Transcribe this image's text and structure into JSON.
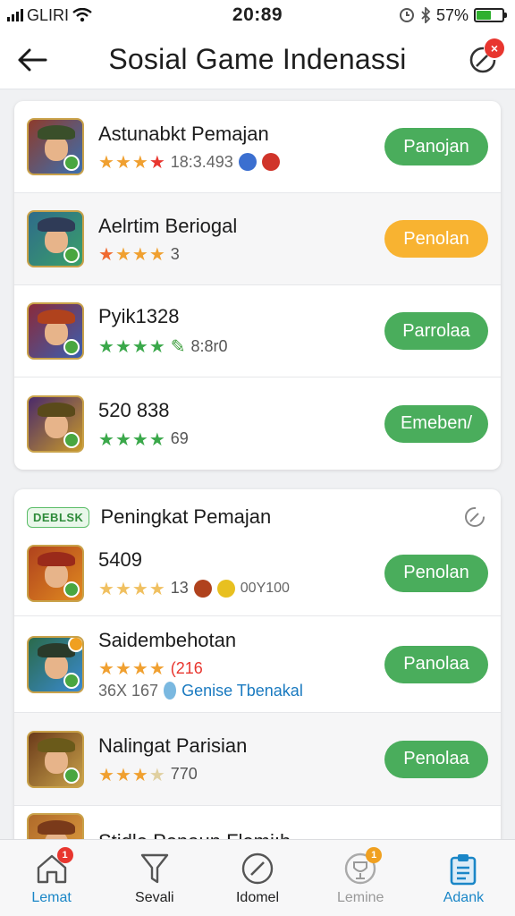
{
  "status_bar": {
    "carrier": "GLIRI",
    "time": "20:89",
    "battery": "57%",
    "battery_level": 0.57
  },
  "header": {
    "title": "Sosial Game Indenassi",
    "notification_badge": "×"
  },
  "section1": {
    "rows": [
      {
        "name": "Astunabkt Pemajan",
        "rating_text": "",
        "stars": 4,
        "star_colors": [
          "#f0a030",
          "#f0a030",
          "#f0a030",
          "#e8362f"
        ],
        "sub": "18:3.493",
        "button": "Panojan",
        "button_color": "green",
        "shaded": false,
        "avatar_colors": [
          "#8e3b2b",
          "#3b6fb0"
        ],
        "hat_color": "#3a4f2a",
        "meta_icon": "chips"
      },
      {
        "name": "Aelrtim Beriogal",
        "rating_text": "3",
        "stars": 4,
        "star_colors": [
          "#f06a30",
          "#f0a030",
          "#f0a030",
          "#f0a030"
        ],
        "sub": "",
        "button": "Penolan",
        "button_color": "orange",
        "shaded": true,
        "avatar_colors": [
          "#2e6b8a",
          "#3aa06a"
        ],
        "hat_color": "#2f3b57",
        "meta_icon": "none"
      },
      {
        "name": "Pyik1328",
        "rating_text": "8:8r0",
        "stars": 4,
        "star_colors": [
          "#3aa84a",
          "#3aa84a",
          "#3aa84a",
          "#3aa84a"
        ],
        "sub": "",
        "button": "Parrolaa",
        "button_color": "green",
        "shaded": false,
        "avatar_colors": [
          "#8a2a3a",
          "#3a5fb0"
        ],
        "hat_color": "#b0421d",
        "meta_icon": "pen"
      },
      {
        "name": "520 838",
        "rating_text": "69",
        "stars": 4,
        "star_colors": [
          "#3aa84a",
          "#3aa84a",
          "#3aa84a",
          "#3aa84a"
        ],
        "sub": "",
        "button": "Emeben/",
        "button_color": "green",
        "shaded": false,
        "avatar_colors": [
          "#4a2a6a",
          "#c99a2a"
        ],
        "hat_color": "#5a4a1a",
        "meta_icon": "none"
      }
    ]
  },
  "section2": {
    "tag": "DEBLSK",
    "title": "Peningkat Pemajan",
    "rows": [
      {
        "name": "5409",
        "rating_text": "13",
        "stars": 4,
        "star_colors": [
          "#f0c060",
          "#f0c060",
          "#f0c060",
          "#f0c060"
        ],
        "sub": "00Y100",
        "extra": "",
        "button": "Penolan",
        "button_color": "green",
        "shaded": false,
        "avatar_colors": [
          "#b0421d",
          "#e08a20"
        ],
        "hat_color": "#9a2a1a",
        "meta_icon": "chips2",
        "dot": false
      },
      {
        "name": "Saidembehotan",
        "rating_text": "(216",
        "stars": 4,
        "star_colors": [
          "#f0a030",
          "#f0a030",
          "#f0a030",
          "#f0a030"
        ],
        "sub": "36X 167",
        "extra": "Genise Tbenakal",
        "button": "Panolaa",
        "button_color": "green",
        "shaded": false,
        "avatar_colors": [
          "#2a6a4a",
          "#3a8ad0"
        ],
        "hat_color": "#2a3a2a",
        "meta_icon": "pin",
        "dot": true
      },
      {
        "name": "Nalingat Parisian",
        "rating_text": "770",
        "stars": 4,
        "star_colors": [
          "#f0a030",
          "#f0a030",
          "#f0a030",
          "#e0d0a0"
        ],
        "sub": "",
        "extra": "",
        "button": "Penolaa",
        "button_color": "green",
        "shaded": true,
        "avatar_colors": [
          "#6a3a1a",
          "#c9a24a"
        ],
        "hat_color": "#6a5a1a",
        "meta_icon": "none",
        "dot": false
      },
      {
        "name": "Stidle Penaun Flemi:h",
        "rating_text": "",
        "stars": 0,
        "star_colors": [],
        "sub": "",
        "extra": "",
        "button": "",
        "button_color": "green",
        "shaded": false,
        "avatar_colors": [
          "#b06a2a",
          "#e0a040"
        ],
        "hat_color": "#7a3a1a",
        "meta_icon": "none",
        "dot": false
      }
    ]
  },
  "nav": {
    "items": [
      {
        "label": "Lemat",
        "icon": "home-icon",
        "badge": "1",
        "badge_color": "#e8362f",
        "active": false
      },
      {
        "label": "Sevali",
        "icon": "funnel-icon",
        "badge": "",
        "badge_color": "",
        "active": false
      },
      {
        "label": "Idomel",
        "icon": "edit-icon",
        "badge": "",
        "badge_color": "",
        "active": false
      },
      {
        "label": "Lemine",
        "icon": "trophy-icon",
        "badge": "1",
        "badge_color": "#f0a020",
        "active": false
      },
      {
        "label": "Adank",
        "icon": "clipboard-icon",
        "badge": "",
        "badge_color": "",
        "active": true
      }
    ]
  }
}
